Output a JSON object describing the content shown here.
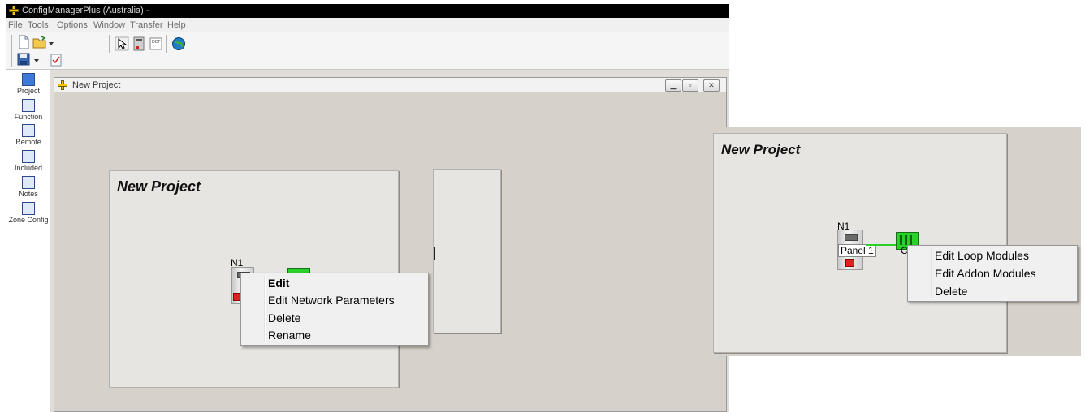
{
  "window": {
    "title": "ConfigManagerPlus (Australia) -"
  },
  "menu": [
    "File",
    "Tools",
    "Options",
    "Window",
    "Transfer",
    "Help"
  ],
  "toolbar": {
    "icons": [
      "new-file-icon",
      "open-folder-icon",
      "dropdown-arrow-icon",
      "save-icon",
      "dropdown-arrow-icon",
      "checklist-icon",
      "pointer-tool-icon",
      "panel-tool-icon",
      "pdf-export-icon",
      "globe-icon"
    ]
  },
  "sidebar": {
    "items": [
      {
        "label": "Project",
        "icon": "project-icon"
      },
      {
        "label": "Function",
        "icon": "function-icon"
      },
      {
        "label": "Remote",
        "icon": "remote-icon"
      },
      {
        "label": "Included",
        "icon": "included-icon"
      },
      {
        "label": "Notes",
        "icon": "notes-icon"
      },
      {
        "label": "Zone Config",
        "icon": "zone-config-icon"
      }
    ]
  },
  "child_window": {
    "title": "New Project",
    "controls": [
      "minimize",
      "restore",
      "close"
    ]
  },
  "canvas_left": {
    "title": "New Project",
    "node_label": "N1",
    "panel_partial": "P",
    "context_menu": [
      "Edit",
      "Edit Network Parameters",
      "Delete",
      "Rename"
    ]
  },
  "canvas_right": {
    "title": "New Project",
    "node_label": "N1",
    "panel_label": "Panel 1",
    "loop_partial": "C",
    "context_menu": [
      "Edit Loop Modules",
      "Edit Addon Modules",
      "Delete"
    ]
  },
  "colors": {
    "loop_green": "#2bd12b",
    "titlebar": "#000000",
    "mdi_bg": "#d6d1ca"
  }
}
